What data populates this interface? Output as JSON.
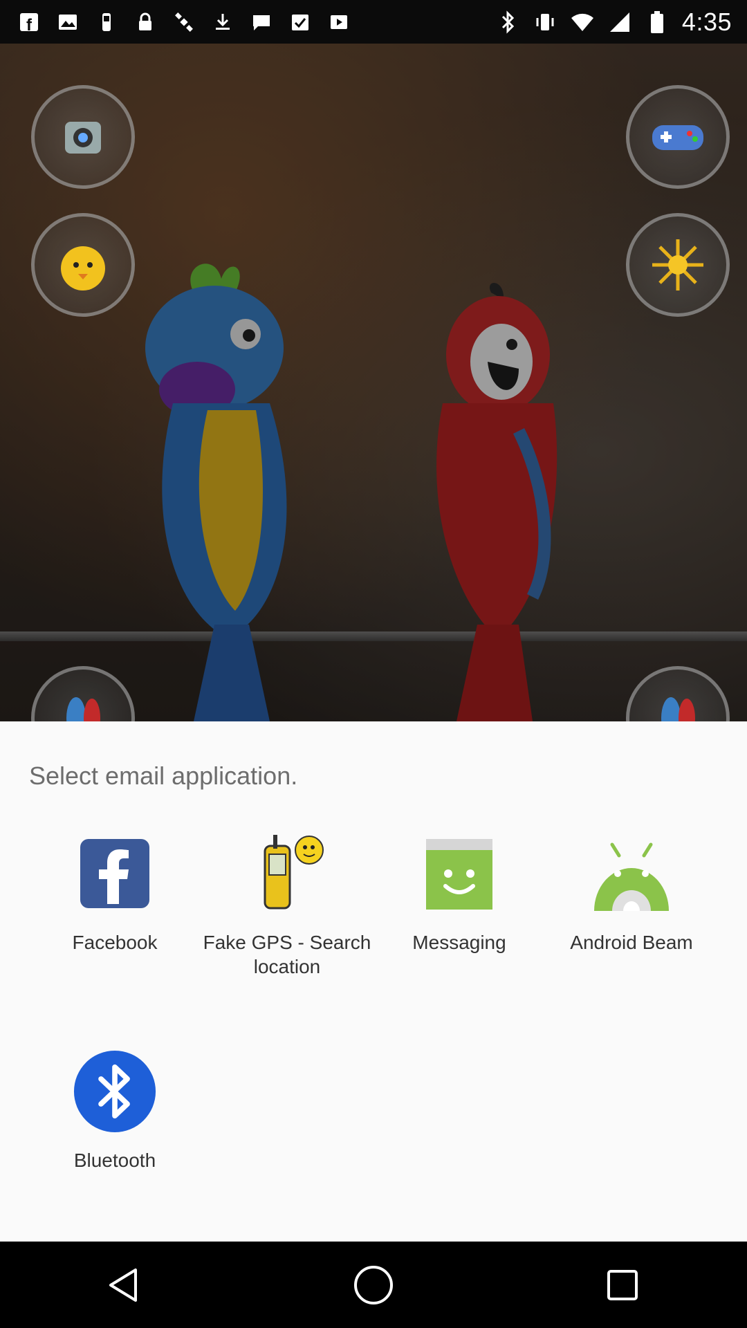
{
  "status_bar": {
    "time": "4:35",
    "left_icons": [
      "facebook-icon",
      "image-icon",
      "fake-gps-icon",
      "lock-icon",
      "satellite-icon",
      "download-icon",
      "message-icon",
      "task-icon",
      "play-icon"
    ],
    "right_icons": [
      "bluetooth-icon",
      "vibrate-icon",
      "wifi-icon",
      "signal-icon",
      "battery-icon"
    ]
  },
  "share_sheet": {
    "title": "Select email application.",
    "apps": [
      {
        "label": "Facebook",
        "icon": "facebook-icon",
        "color": "#3b5998"
      },
      {
        "label": "Fake GPS - Search location",
        "icon": "fake-gps-icon",
        "color": "#f2d21b"
      },
      {
        "label": "Messaging",
        "icon": "messaging-icon",
        "color": "#8bc34a"
      },
      {
        "label": "Android Beam",
        "icon": "android-beam-icon",
        "color": "#8bc34a"
      },
      {
        "label": "Bluetooth",
        "icon": "bluetooth-icon",
        "color": "#1e5fd8"
      }
    ]
  },
  "nav_bar": {
    "buttons": [
      "back-icon",
      "home-icon",
      "recents-icon"
    ]
  }
}
